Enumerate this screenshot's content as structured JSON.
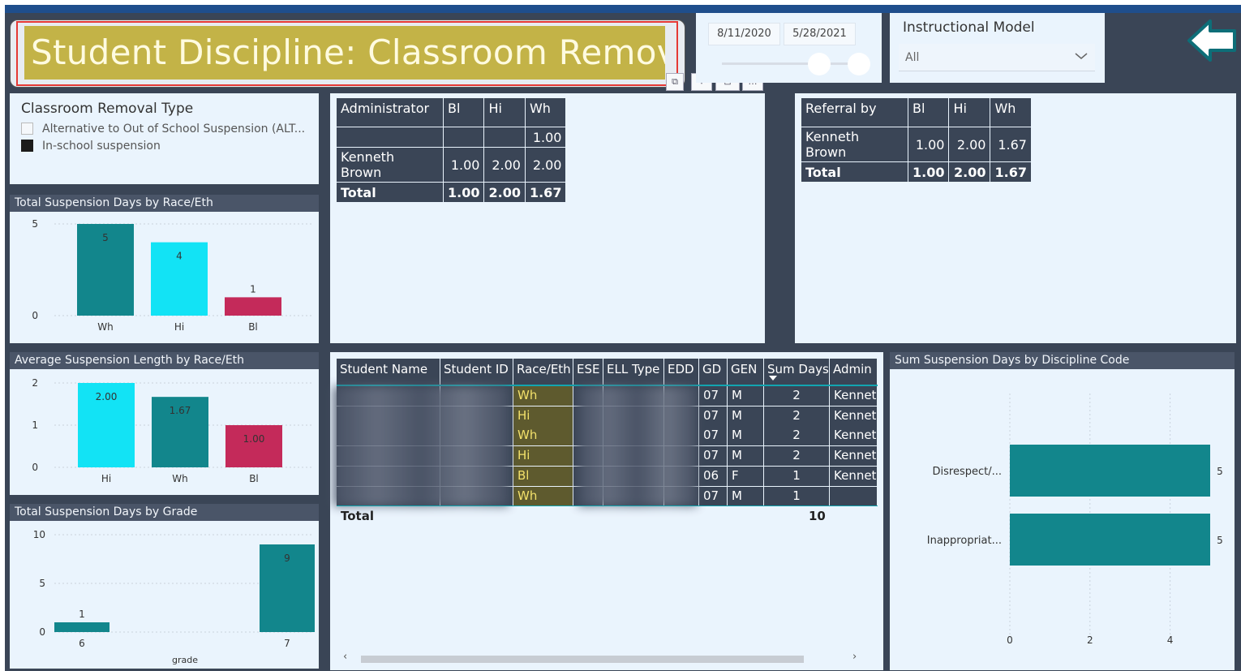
{
  "title": "Student Discipline: Classroom Removals",
  "date_slicer": {
    "start": "8/11/2020",
    "end": "5/28/2021"
  },
  "instructional_model": {
    "label": "Instructional Model",
    "value": "All"
  },
  "removal_type": {
    "title": "Classroom Removal Type",
    "options": [
      {
        "label": "Alternative to Out of School Suspension (ALT...",
        "checked": false
      },
      {
        "label": "In-school suspension",
        "checked": true
      }
    ]
  },
  "admin_matrix": {
    "headers": [
      "Administrator",
      "Bl",
      "Hi",
      "Wh"
    ],
    "rows": [
      [
        "",
        "",
        "",
        "1.00"
      ],
      [
        "Kenneth Brown",
        "1.00",
        "2.00",
        "2.00"
      ]
    ],
    "total": [
      "Total",
      "1.00",
      "2.00",
      "1.67"
    ]
  },
  "referral_matrix": {
    "headers": [
      "Referral by",
      "Bl",
      "Hi",
      "Wh"
    ],
    "rows": [
      [
        "Kenneth Brown",
        "1.00",
        "2.00",
        "1.67"
      ]
    ],
    "total": [
      "Total",
      "1.00",
      "2.00",
      "1.67"
    ]
  },
  "detail_table": {
    "headers": [
      "Student Name",
      "Student ID",
      "Race/Eth",
      "ESE",
      "ELL Type",
      "EDD",
      "GD",
      "GEN",
      "Sum Days",
      "Admin"
    ],
    "rows": [
      {
        "race": "Wh",
        "gd": "07",
        "gen": "M",
        "days": "2",
        "admin": "Kenneth"
      },
      {
        "race": "Hi",
        "gd": "07",
        "gen": "M",
        "days": "2",
        "admin": "Kenneth"
      },
      {
        "race": "Wh",
        "gd": "07",
        "gen": "M",
        "days": "2",
        "admin": "Kenneth"
      },
      {
        "race": "Hi",
        "gd": "07",
        "gen": "M",
        "days": "2",
        "admin": "Kenneth"
      },
      {
        "race": "Bl",
        "gd": "06",
        "gen": "F",
        "days": "1",
        "admin": "Kenneth"
      },
      {
        "race": "Wh",
        "gd": "07",
        "gen": "M",
        "days": "1",
        "admin": ""
      }
    ],
    "total_label": "Total",
    "total_days": "10"
  },
  "colors": {
    "teal": "#12868c",
    "cyan": "#12e3f5",
    "crimson": "#c42a5a",
    "dark": "#3a4556",
    "panel": "#eaf4fd"
  },
  "chart_data": [
    {
      "id": "race_total",
      "type": "bar",
      "title": "Total Suspension Days by Race/Eth",
      "categories": [
        "Wh",
        "Hi",
        "Bl"
      ],
      "values": [
        5,
        4,
        1
      ],
      "colors": [
        "#12868c",
        "#12e3f5",
        "#c42a5a"
      ],
      "ylim": [
        0,
        5
      ],
      "yticks": [
        0,
        5
      ],
      "xlabel": "",
      "ylabel": ""
    },
    {
      "id": "race_avg",
      "type": "bar",
      "title": "Average Suspension Length by Race/Eth",
      "categories": [
        "Hi",
        "Wh",
        "Bl"
      ],
      "values": [
        2.0,
        1.67,
        1.0
      ],
      "labels": [
        "2.00",
        "1.67",
        "1.00"
      ],
      "colors": [
        "#12e3f5",
        "#12868c",
        "#c42a5a"
      ],
      "ylim": [
        0,
        2
      ],
      "yticks": [
        0,
        1,
        2
      ],
      "xlabel": "",
      "ylabel": ""
    },
    {
      "id": "grade_total",
      "type": "bar",
      "title": "Total Suspension Days by Grade",
      "categories": [
        "6",
        "7"
      ],
      "values": [
        1,
        9
      ],
      "colors": [
        "#12868c",
        "#12868c"
      ],
      "ylim": [
        0,
        10
      ],
      "yticks": [
        0,
        5,
        10
      ],
      "xlabel": "grade",
      "ylabel": ""
    },
    {
      "id": "code_total",
      "type": "bar",
      "orientation": "horizontal",
      "title": "Sum Suspension Days by Discipline Code",
      "categories": [
        "Disrespect/...",
        "Inappropriat..."
      ],
      "values": [
        5,
        5
      ],
      "colors": [
        "#12868c",
        "#12868c"
      ],
      "xlim": [
        0,
        5
      ],
      "xticks": [
        0,
        2,
        4
      ],
      "xlabel": "",
      "ylabel": ""
    }
  ]
}
